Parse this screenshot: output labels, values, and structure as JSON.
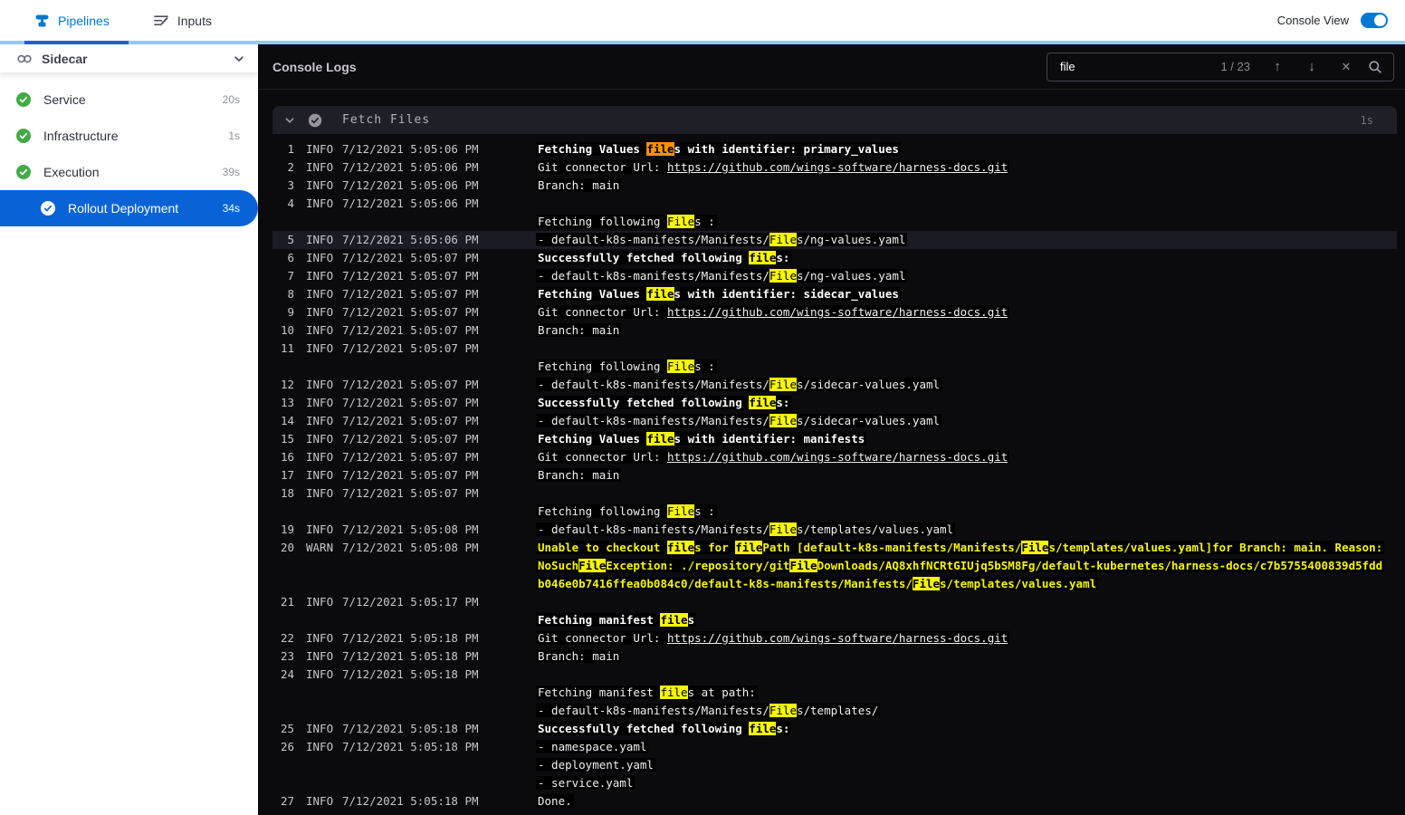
{
  "colors": {
    "accent": "#0278d5",
    "accent_bar": "#7ed4f5",
    "selected_step_blue": "#0a63d6",
    "success_green": "#42ab45",
    "match_current": "#ff9100",
    "match_other": "#f8f800",
    "warn_text": "#f6f600"
  },
  "top_nav": {
    "tabs": [
      {
        "label": "Pipelines",
        "active": true
      },
      {
        "label": "Inputs",
        "active": false
      }
    ],
    "console_view_label": "Console View",
    "console_view_on": true
  },
  "sidebar": {
    "stage_label": "Sidecar",
    "items": [
      {
        "label": "Service",
        "duration": "20s",
        "status": "success",
        "selected": false
      },
      {
        "label": "Infrastructure",
        "duration": "1s",
        "status": "success",
        "selected": false
      },
      {
        "label": "Execution",
        "duration": "39s",
        "status": "success",
        "selected": false
      },
      {
        "label": "Rollout Deployment",
        "duration": "34s",
        "status": "success",
        "selected": true
      }
    ]
  },
  "console": {
    "title": "Console Logs",
    "search": {
      "query": "file",
      "counter": "1 / 23",
      "prev_icon": "↑",
      "next_icon": "↓",
      "clear_icon": "✕"
    },
    "section": {
      "title": "Fetch Files",
      "duration": "1s"
    },
    "logs": [
      {
        "num": 1,
        "level": "INFO",
        "time": "7/12/2021 5:05:06 PM",
        "lines": [
          {
            "b": true,
            "s": [
              {
                "t": "Fetching Values "
              },
              {
                "t": "file",
                "h": "o"
              },
              {
                "t": "s with identifier: primary_values"
              }
            ]
          }
        ]
      },
      {
        "num": 2,
        "level": "INFO",
        "time": "7/12/2021 5:05:06 PM",
        "lines": [
          {
            "s": [
              {
                "t": "Git connector Url: "
              },
              {
                "t": "https://github.com/wings-software/harness-docs.git",
                "u": true
              }
            ]
          }
        ]
      },
      {
        "num": 3,
        "level": "INFO",
        "time": "7/12/2021 5:05:06 PM",
        "lines": [
          {
            "s": [
              {
                "t": "Branch: main"
              }
            ]
          }
        ]
      },
      {
        "num": 4,
        "level": "INFO",
        "time": "7/12/2021 5:05:06 PM",
        "lines": [
          {
            "s": []
          },
          {
            "s": [
              {
                "t": "Fetching following "
              },
              {
                "t": "File",
                "h": "y"
              },
              {
                "t": "s :"
              }
            ]
          }
        ]
      },
      {
        "num": 5,
        "level": "INFO",
        "time": "7/12/2021 5:05:06 PM",
        "row_highlight": true,
        "lines": [
          {
            "s": [
              {
                "t": "- default-k8s-manifests/Manifests/"
              },
              {
                "t": "File",
                "h": "y"
              },
              {
                "t": "s/ng-values.yaml"
              }
            ]
          }
        ]
      },
      {
        "num": 6,
        "level": "INFO",
        "time": "7/12/2021 5:05:07 PM",
        "lines": [
          {
            "b": true,
            "s": [
              {
                "t": "Successfully fetched following "
              },
              {
                "t": "file",
                "h": "y"
              },
              {
                "t": "s:"
              }
            ]
          }
        ]
      },
      {
        "num": 7,
        "level": "INFO",
        "time": "7/12/2021 5:05:07 PM",
        "lines": [
          {
            "s": [
              {
                "t": "- default-k8s-manifests/Manifests/"
              },
              {
                "t": "File",
                "h": "y"
              },
              {
                "t": "s/ng-values.yaml"
              }
            ]
          }
        ]
      },
      {
        "num": 8,
        "level": "INFO",
        "time": "7/12/2021 5:05:07 PM",
        "lines": [
          {
            "b": true,
            "s": [
              {
                "t": "Fetching Values "
              },
              {
                "t": "file",
                "h": "y"
              },
              {
                "t": "s with identifier: sidecar_values"
              }
            ]
          }
        ]
      },
      {
        "num": 9,
        "level": "INFO",
        "time": "7/12/2021 5:05:07 PM",
        "lines": [
          {
            "s": [
              {
                "t": "Git connector Url: "
              },
              {
                "t": "https://github.com/wings-software/harness-docs.git",
                "u": true
              }
            ]
          }
        ]
      },
      {
        "num": 10,
        "level": "INFO",
        "time": "7/12/2021 5:05:07 PM",
        "lines": [
          {
            "s": [
              {
                "t": "Branch: main"
              }
            ]
          }
        ]
      },
      {
        "num": 11,
        "level": "INFO",
        "time": "7/12/2021 5:05:07 PM",
        "lines": [
          {
            "s": []
          },
          {
            "s": [
              {
                "t": "Fetching following "
              },
              {
                "t": "File",
                "h": "y"
              },
              {
                "t": "s :"
              }
            ]
          }
        ]
      },
      {
        "num": 12,
        "level": "INFO",
        "time": "7/12/2021 5:05:07 PM",
        "lines": [
          {
            "s": [
              {
                "t": "- default-k8s-manifests/Manifests/"
              },
              {
                "t": "File",
                "h": "y"
              },
              {
                "t": "s/sidecar-values.yaml"
              }
            ]
          }
        ]
      },
      {
        "num": 13,
        "level": "INFO",
        "time": "7/12/2021 5:05:07 PM",
        "lines": [
          {
            "b": true,
            "s": [
              {
                "t": "Successfully fetched following "
              },
              {
                "t": "file",
                "h": "y"
              },
              {
                "t": "s:"
              }
            ]
          }
        ]
      },
      {
        "num": 14,
        "level": "INFO",
        "time": "7/12/2021 5:05:07 PM",
        "lines": [
          {
            "s": [
              {
                "t": "- default-k8s-manifests/Manifests/"
              },
              {
                "t": "File",
                "h": "y"
              },
              {
                "t": "s/sidecar-values.yaml"
              }
            ]
          }
        ]
      },
      {
        "num": 15,
        "level": "INFO",
        "time": "7/12/2021 5:05:07 PM",
        "lines": [
          {
            "b": true,
            "s": [
              {
                "t": "Fetching Values "
              },
              {
                "t": "file",
                "h": "y"
              },
              {
                "t": "s with identifier: manifests"
              }
            ]
          }
        ]
      },
      {
        "num": 16,
        "level": "INFO",
        "time": "7/12/2021 5:05:07 PM",
        "lines": [
          {
            "s": [
              {
                "t": "Git connector Url: "
              },
              {
                "t": "https://github.com/wings-software/harness-docs.git",
                "u": true
              }
            ]
          }
        ]
      },
      {
        "num": 17,
        "level": "INFO",
        "time": "7/12/2021 5:05:07 PM",
        "lines": [
          {
            "s": [
              {
                "t": "Branch: main"
              }
            ]
          }
        ]
      },
      {
        "num": 18,
        "level": "INFO",
        "time": "7/12/2021 5:05:07 PM",
        "lines": [
          {
            "s": []
          },
          {
            "s": [
              {
                "t": "Fetching following "
              },
              {
                "t": "File",
                "h": "y"
              },
              {
                "t": "s :"
              }
            ]
          }
        ]
      },
      {
        "num": 19,
        "level": "INFO",
        "time": "7/12/2021 5:05:08 PM",
        "lines": [
          {
            "s": [
              {
                "t": "- default-k8s-manifests/Manifests/"
              },
              {
                "t": "File",
                "h": "y"
              },
              {
                "t": "s/templates/values.yaml"
              }
            ]
          }
        ]
      },
      {
        "num": 20,
        "level": "WARN",
        "time": "7/12/2021 5:05:08 PM",
        "lines": [
          {
            "b": true,
            "warn": true,
            "s": [
              {
                "t": "Unable to checkout "
              },
              {
                "t": "file",
                "h": "y"
              },
              {
                "t": "s for "
              },
              {
                "t": "file",
                "h": "y"
              },
              {
                "t": "Path [default-k8s-manifests/Manifests/"
              },
              {
                "t": "File",
                "h": "y"
              },
              {
                "t": "s/templates/values.yaml]for Branch: main. Reason: NoSuch"
              },
              {
                "t": "File",
                "h": "y"
              },
              {
                "t": "Exception: ./repository/git"
              },
              {
                "t": "File",
                "h": "y"
              },
              {
                "t": "Downloads/AQ8xhfNCRtGIUjq5bSM8Fg/default-kubernetes/harness-docs/c7b5755400839d5fddb046e0b7416ffea0b084c0/default-k8s-manifests/Manifests/"
              },
              {
                "t": "File",
                "h": "y"
              },
              {
                "t": "s/templates/values.yaml"
              }
            ]
          }
        ]
      },
      {
        "num": 21,
        "level": "INFO",
        "time": "7/12/2021 5:05:17 PM",
        "lines": [
          {
            "s": []
          },
          {
            "b": true,
            "s": [
              {
                "t": "Fetching manifest "
              },
              {
                "t": "file",
                "h": "y"
              },
              {
                "t": "s"
              }
            ]
          }
        ]
      },
      {
        "num": 22,
        "level": "INFO",
        "time": "7/12/2021 5:05:18 PM",
        "lines": [
          {
            "s": [
              {
                "t": "Git connector Url: "
              },
              {
                "t": "https://github.com/wings-software/harness-docs.git",
                "u": true
              }
            ]
          }
        ]
      },
      {
        "num": 23,
        "level": "INFO",
        "time": "7/12/2021 5:05:18 PM",
        "lines": [
          {
            "s": [
              {
                "t": "Branch: main"
              }
            ]
          }
        ]
      },
      {
        "num": 24,
        "level": "INFO",
        "time": "7/12/2021 5:05:18 PM",
        "lines": [
          {
            "s": []
          },
          {
            "s": [
              {
                "t": "Fetching manifest "
              },
              {
                "t": "file",
                "h": "y"
              },
              {
                "t": "s at path:"
              }
            ]
          },
          {
            "s": [
              {
                "t": "- default-k8s-manifests/Manifests/"
              },
              {
                "t": "File",
                "h": "y"
              },
              {
                "t": "s/templates/"
              }
            ]
          }
        ]
      },
      {
        "num": 25,
        "level": "INFO",
        "time": "7/12/2021 5:05:18 PM",
        "lines": [
          {
            "b": true,
            "s": [
              {
                "t": "Successfully fetched following "
              },
              {
                "t": "file",
                "h": "y"
              },
              {
                "t": "s:"
              }
            ]
          }
        ]
      },
      {
        "num": 26,
        "level": "INFO",
        "time": "7/12/2021 5:05:18 PM",
        "lines": [
          {
            "s": [
              {
                "t": "- namespace.yaml"
              }
            ]
          },
          {
            "s": [
              {
                "t": "- deployment.yaml"
              }
            ]
          },
          {
            "s": [
              {
                "t": "- service.yaml"
              }
            ]
          }
        ]
      },
      {
        "num": 27,
        "level": "INFO",
        "time": "7/12/2021 5:05:18 PM",
        "lines": [
          {
            "s": [
              {
                "t": "Done."
              }
            ]
          }
        ]
      }
    ]
  }
}
